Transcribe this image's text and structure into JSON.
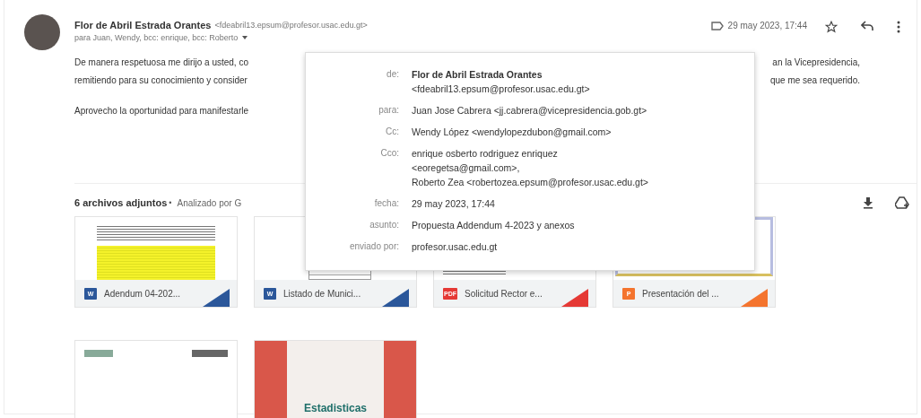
{
  "message": {
    "sender_name": "Flor de Abril Estrada Orantes",
    "sender_email": "<fdeabril13.epsum@profesor.usac.edu.gt>",
    "recipients": "para Juan, Wendy, bcc: enrique, bcc: Roberto",
    "date": "29 may 2023, 17:44",
    "starred": false
  },
  "body": [
    {
      "left": "De manera respetuosa me dirijo a usted, co",
      "right": "an la Vicepresidencia,"
    },
    {
      "left": "remitiendo para su conocimiento y consider",
      "right": "que me sea requerido."
    },
    {
      "left": "Aprovecho la oportunidad para manifestarle"
    }
  ],
  "details_popup": {
    "rows": [
      {
        "label": "de:",
        "lines": [
          "**Flor de Abril Estrada Orantes**",
          "<fdeabril13.epsum@profesor.usac.edu.gt>"
        ]
      },
      {
        "label": "para:",
        "lines": [
          "Juan Jose Cabrera <jj.cabrera@vicepresidencia.gob.gt>"
        ]
      },
      {
        "label": "Cc:",
        "lines": [
          "Wendy López <wendylopezdubon@gmail.com>"
        ]
      },
      {
        "label": "Cco:",
        "lines": [
          "enrique osberto rodriguez enriquez",
          "<eoregetsa@gmail.com>,",
          "Roberto Zea <robertozea.epsum@profesor.usac.edu.gt>"
        ]
      },
      {
        "label": "fecha:",
        "lines": [
          "29 may 2023, 17:44"
        ]
      },
      {
        "label": "asunto:",
        "lines": [
          "Propuesta Addendum 4-2023 y anexos"
        ]
      },
      {
        "label": "enviado por:",
        "lines": [
          "profesor.usac.edu.gt"
        ]
      }
    ]
  },
  "attachments": {
    "title": "6 archivos adjuntos",
    "separator": "•",
    "scan_note": "Analizado por G",
    "items": [
      {
        "kind": "word",
        "icon_text": "W",
        "name": "Adendum 04-202...",
        "preview": {
          "kind": "highlight"
        }
      },
      {
        "kind": "word",
        "icon_text": "W",
        "name": "Listado de Munici...",
        "preview": {
          "kind": "table"
        }
      },
      {
        "kind": "pdf",
        "icon_text": "PDF",
        "name": "Solicitud Rector e...",
        "preview": {
          "kind": "letter"
        }
      },
      {
        "kind": "ppt",
        "icon_text": "P",
        "name": "Presentación del ...",
        "preview": {
          "kind": "slide"
        }
      },
      {
        "kind": "preview",
        "preview": {
          "kind": "logos"
        }
      },
      {
        "kind": "preview",
        "preview": {
          "kind": "cover",
          "title": "Estadisticas"
        }
      }
    ]
  }
}
